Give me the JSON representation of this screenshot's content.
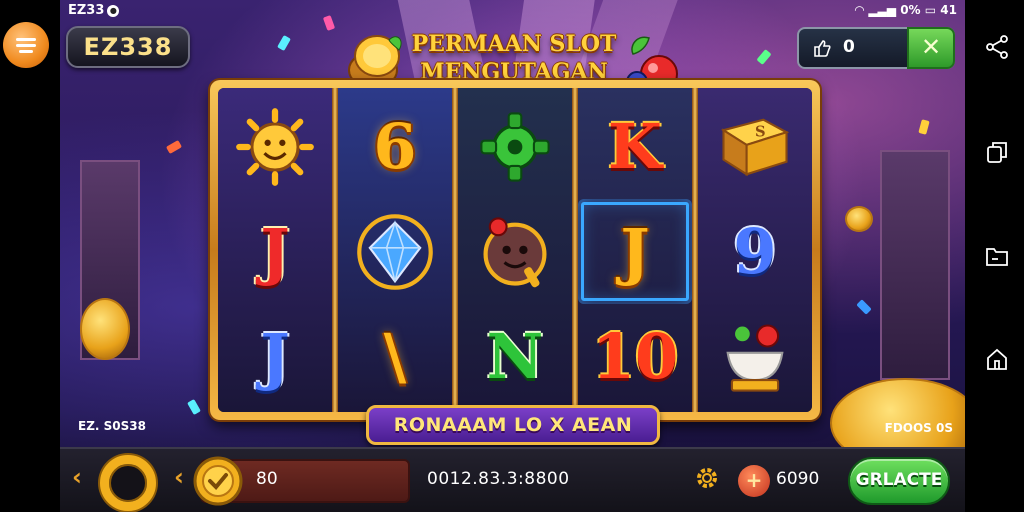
{
  "status_bar": {
    "left_text": "EZ33",
    "right_text": "0%",
    "extra": "41"
  },
  "header": {
    "brand": "EZ338",
    "title_line1": "PERMAAN SLOT",
    "title_line2": "MENGUTAGAN",
    "win_value": "0"
  },
  "reels": [
    [
      {
        "icon": "sun-icon"
      },
      {
        "text": "J",
        "style": "red"
      },
      {
        "text": "J",
        "style": "blue"
      }
    ],
    [
      {
        "text": "6",
        "style": "gold"
      },
      {
        "icon": "diamond-icon"
      },
      {
        "text": "\\",
        "style": "gold"
      }
    ],
    [
      {
        "icon": "green-gear-icon"
      },
      {
        "icon": "creature-icon"
      },
      {
        "text": "N",
        "style": "green"
      }
    ],
    [
      {
        "text": "K",
        "style": "redgold"
      },
      {
        "text": "J",
        "style": "gold",
        "highlight": true
      },
      {
        "text": "10",
        "style": "redgold"
      }
    ],
    [
      {
        "icon": "gold-block-icon"
      },
      {
        "text": "9",
        "style": "blue"
      },
      {
        "icon": "fruit-bowl-icon"
      }
    ]
  ],
  "banner": "RONAAAM LO X AEAN",
  "corner_left": "EZ. S0S38",
  "corner_right": "FDOOS 0S",
  "bottom": {
    "bet_value": "80",
    "balance_value": "0012.83.3:8800",
    "credit_value": "6090",
    "action_label": "GRLACTE"
  },
  "colors": {
    "accent_gold": "#f2b01e",
    "action_green": "#2ea83a",
    "banner_purple": "#5a2aa8"
  }
}
